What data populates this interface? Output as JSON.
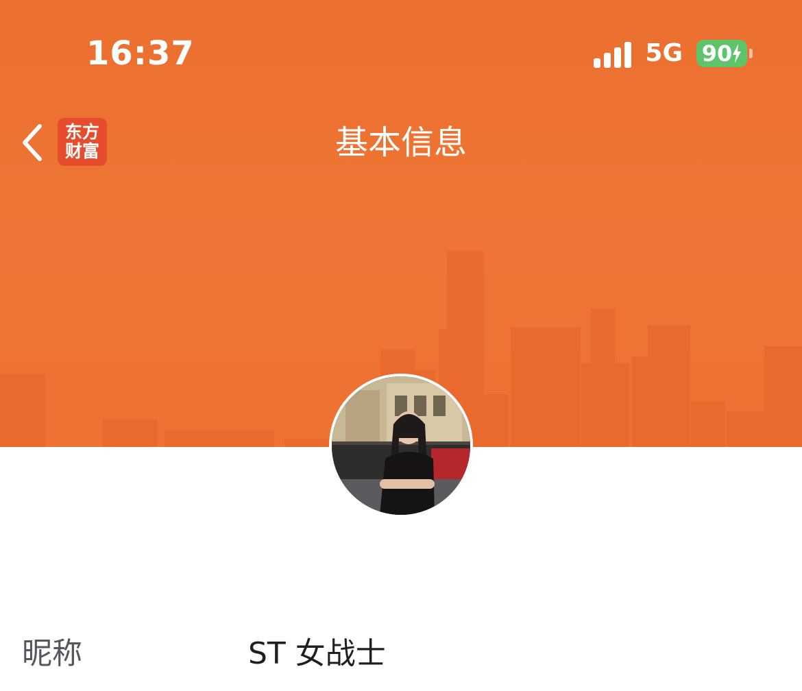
{
  "status_bar": {
    "time": "16:37",
    "network": "5G",
    "battery": "90",
    "icons": [
      "signal-icon",
      "battery-charging-icon"
    ]
  },
  "nav": {
    "back_icon": "chevron-left-icon",
    "app_badge_line1": "东方",
    "app_badge_line2": "财富",
    "title": "基本信息"
  },
  "profile": {
    "avatar_icon": "user-avatar-photo"
  },
  "fields": [
    {
      "label": "昵称",
      "value": "ST 女战士"
    }
  ],
  "colors": {
    "header_bg": "#ee7232",
    "skyline": "#e85f24",
    "badge_bg": "#e54d2c",
    "battery": "#5fc36a",
    "label_text": "#55575c",
    "value_text": "#1f1f22"
  }
}
